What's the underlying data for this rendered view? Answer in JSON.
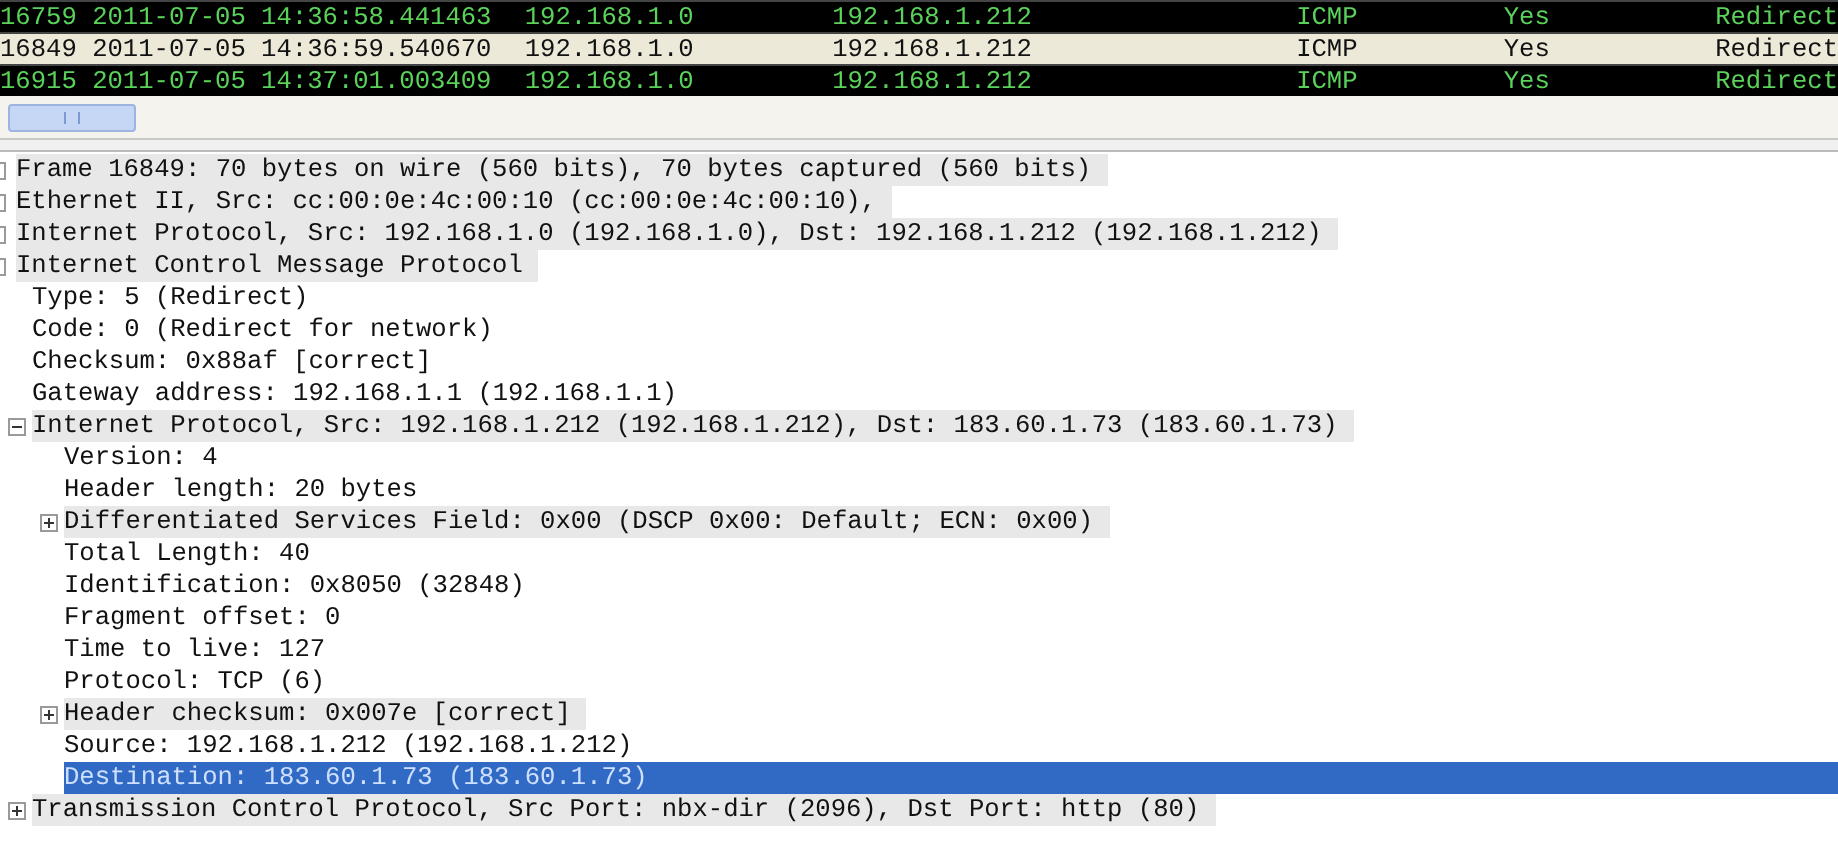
{
  "packets": [
    {
      "cells": [
        "16759 2011-07-05 14:36:58.441463",
        "192.168.1.0",
        "192.168.1.212",
        "ICMP",
        "Yes",
        "Redirect"
      ],
      "selected": false
    },
    {
      "cells": [
        "16849 2011-07-05 14:36:59.540670",
        "192.168.1.0",
        "192.168.1.212",
        "ICMP",
        "Yes",
        "Redirect"
      ],
      "selected": true
    },
    {
      "cells": [
        "16915 2011-07-05 14:37:01.003409",
        "192.168.1.0",
        "192.168.1.212",
        "ICMP",
        "Yes",
        "Redirect"
      ],
      "selected": false
    }
  ],
  "tree": [
    {
      "label": "Frame 16849: 70 bytes on wire (560 bits), 70 bytes captured (560 bits)",
      "selected": false
    },
    {
      "label": "Ethernet II, Src: cc:00:0e:4c:00:10 (cc:00:0e:4c:00:10),",
      "selected": false
    },
    {
      "label": "Internet Protocol, Src: 192.168.1.0 (192.168.1.0), Dst: 192.168.1.212 (192.168.1.212)",
      "selected": false
    },
    {
      "label": "Internet Control Message Protocol",
      "selected": false,
      "children": [
        {
          "label": "Type: 5 (Redirect)",
          "selected": false
        },
        {
          "label": "Code: 0 (Redirect for network)",
          "selected": false
        },
        {
          "label": "Checksum: 0x88af [correct]",
          "selected": false
        },
        {
          "label": "Gateway address: 192.168.1.1 (192.168.1.1)",
          "selected": false
        },
        {
          "label": "Internet Protocol, Src: 192.168.1.212 (192.168.1.212), Dst: 183.60.1.73 (183.60.1.73)",
          "expanded": true,
          "selected": false,
          "children": [
            {
              "label": "Version: 4",
              "selected": false
            },
            {
              "label": "Header length: 20 bytes",
              "selected": false
            },
            {
              "label": "Differentiated Services Field: 0x00 (DSCP 0x00: Default; ECN: 0x00)",
              "expanded": false,
              "selected": false
            },
            {
              "label": "Total Length: 40",
              "selected": false
            },
            {
              "label": "Identification: 0x8050 (32848)",
              "selected": false
            },
            {
              "label": "Fragment offset: 0",
              "selected": false
            },
            {
              "label": "Time to live: 127",
              "selected": false
            },
            {
              "label": "Protocol: TCP (6)",
              "selected": false
            },
            {
              "label": "Header checksum: 0x007e [correct]",
              "expanded": false,
              "selected": false
            },
            {
              "label": "Source: 192.168.1.212 (192.168.1.212)",
              "selected": false
            },
            {
              "label": "Destination: 183.60.1.73 (183.60.1.73)",
              "selected": true
            }
          ]
        },
        {
          "label": "Transmission Control Protocol, Src Port: nbx-dir (2096), Dst Port: http (80)",
          "expanded": false,
          "selected": false
        }
      ]
    }
  ]
}
